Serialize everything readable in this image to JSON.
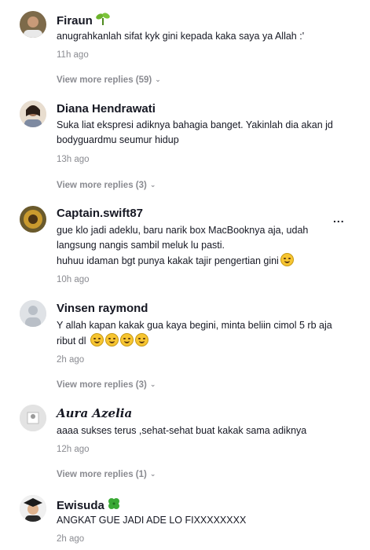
{
  "comments": [
    {
      "username": "Firaun",
      "text": "anugrahkanlah sifat kyk gini kepada kaka saya ya Allah :'",
      "time": "11h ago",
      "replies": "View more replies (59)",
      "badge_icon": "sprout-icon"
    },
    {
      "username": "Diana Hendrawati",
      "text": "Suka liat ekspresi adiknya bahagia banget. Yakinlah dia akan jd bodyguardmu seumur hidup",
      "time": "13h ago",
      "replies": "View more replies (3)"
    },
    {
      "username": "Captain.swift87",
      "text": "gue klo jadi adeklu, baru narik box MacBooknya aja, udah langsung nangis sambil meluk lu pasti.",
      "text2": "huhuu idaman bgt punya kakak tajir pengertian gini",
      "time": "10h ago",
      "more": "..."
    },
    {
      "username": "Vinsen raymond",
      "text": "Y allah kapan kakak gua kaya begini, minta beliin cimol 5 rb aja ribut dl",
      "time": "2h ago",
      "replies": "View more replies (3)"
    },
    {
      "username": "Aura Azelia",
      "text": "aaaa sukses terus ,sehat-sehat buat kakak sama adiknya",
      "time": "12h ago",
      "replies": "View more replies (1)"
    },
    {
      "username": "Ewisuda",
      "text": "ANGKAT GUE JADI ADE LO FIXXXXXXXX",
      "time": "2h ago",
      "badge_icon": "clover-icon"
    }
  ],
  "colors": {
    "text": "#161823",
    "muted": "#8a8b91"
  }
}
